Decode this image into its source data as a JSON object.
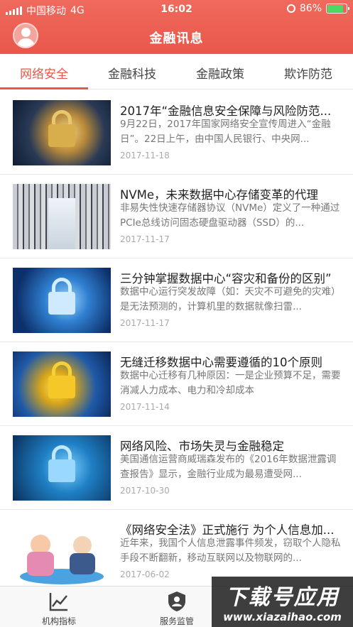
{
  "status_bar": {
    "carrier": "中国移动",
    "network": "4G",
    "time": "16:02",
    "battery": "86%",
    "battery_fraction": 0.86
  },
  "header": {
    "title": "金融讯息"
  },
  "tabs": [
    {
      "label": "网络安全",
      "active": true
    },
    {
      "label": "金融科技",
      "active": false
    },
    {
      "label": "金融政策",
      "active": false
    },
    {
      "label": "欺诈防范",
      "active": false
    }
  ],
  "news": [
    {
      "title": "2017年“金融信息安全保障与风险防范...",
      "summary": "9月22日，2017年国家网络安全宣传周进入“金融日”。22日上午，由中国人民银行、中央网...",
      "date": "2017-11-18",
      "thumb": "gold-lock"
    },
    {
      "title": "NVMe，未来数据中心存储变革的代理",
      "summary": "非易失性快速存储器协议（NVMe）定义了一种通过PCIe总线访问固态硬盘驱动器（SSD）的...",
      "date": "2017-11-17",
      "thumb": "server-room"
    },
    {
      "title": "三分钟掌握数据中心“容灾和备份的区别”",
      "summary": "数据中心运行突发故障（如：天灾不可避免的灾难）是无法预测的，计算机里的数据就像扫雷...",
      "date": "2017-11-17",
      "thumb": "blue-circuit-lock"
    },
    {
      "title": "无缝迁移数据中心需要遵循的10个原则",
      "summary": "数据中心迁移有几种原因：一是企业预算不足，需要消减人力成本、电力和冷却成本",
      "date": "2017-11-14",
      "thumb": "yellow-lock"
    },
    {
      "title": "网络风险、市场失灵与金融稳定",
      "summary": "美国通信运营商威瑞森发布的《2016年数据泄露调查报告》显示，金融行业成为最易遭受网...",
      "date": "2017-10-30",
      "thumb": "blue-lock"
    },
    {
      "title": "《网络安全法》正式施行 为个人信息加...",
      "summary": "近年来，我国个人信息泄露事件频发，窃取个人隐私手段不断翻新，移动互联网以及物联网的...",
      "date": "2017-06-02",
      "thumb": "cartoon"
    }
  ],
  "bottom_nav": [
    {
      "label": "机构指标",
      "icon": "chart-icon"
    },
    {
      "label": "服务监管",
      "icon": "shield-user-icon"
    }
  ],
  "watermark": {
    "main": "下载号应用",
    "sub": "www.xiazaihao.com"
  },
  "colors": {
    "brand": "#e9574a",
    "active_tab": "#e9574a"
  }
}
